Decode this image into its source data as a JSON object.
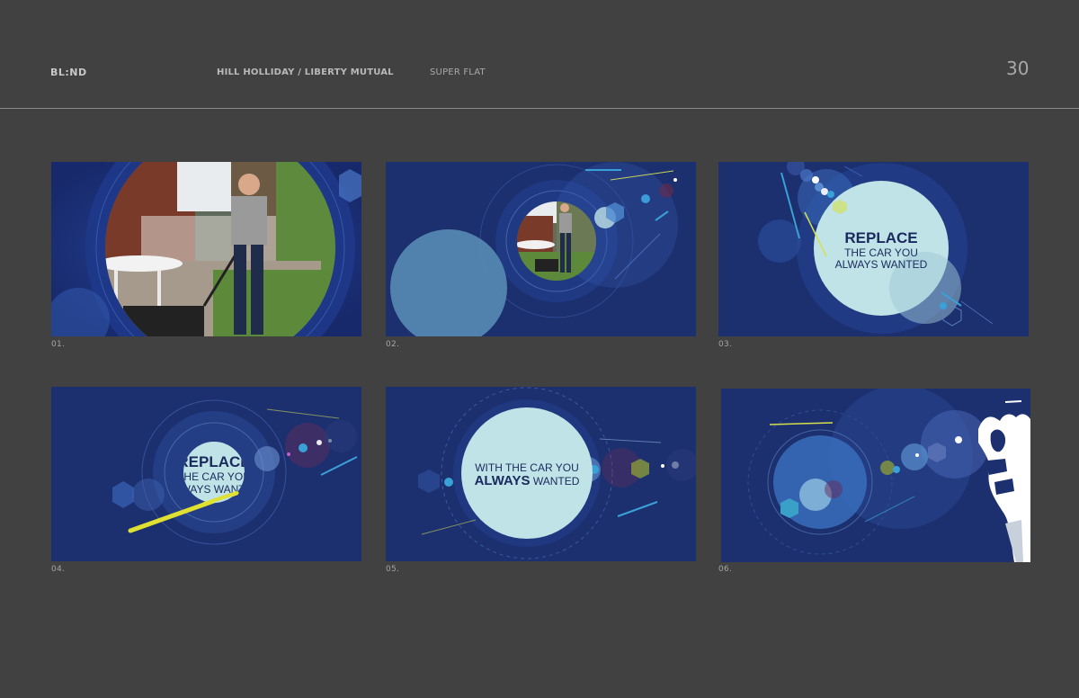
{
  "header": {
    "brand": "BL:ND",
    "client": "HILL HOLLIDAY / LIBERTY MUTUAL",
    "project": "SUPER FLAT",
    "page_number": "30"
  },
  "frames": [
    {
      "caption": "01."
    },
    {
      "caption": "02."
    },
    {
      "caption": "03.",
      "text_line1": "REPLACE",
      "text_line2": "THE CAR YOU",
      "text_line3": "ALWAYS WANTED"
    },
    {
      "caption": "04.",
      "text_line1": "REPLACE",
      "text_line2": "THE CAR YOU",
      "text_line3": "ALWAYS WANTED"
    },
    {
      "caption": "05.",
      "text_line1": "WITH THE CAR YOU",
      "text_line2a": "ALWAYS",
      "text_line2b": " WANTED"
    },
    {
      "caption": "06."
    }
  ],
  "colors": {
    "background": "#414141",
    "frame_blue": "#1c2f6e",
    "light_circle": "#bfe3e6",
    "text_navy": "#1a2a5e"
  }
}
